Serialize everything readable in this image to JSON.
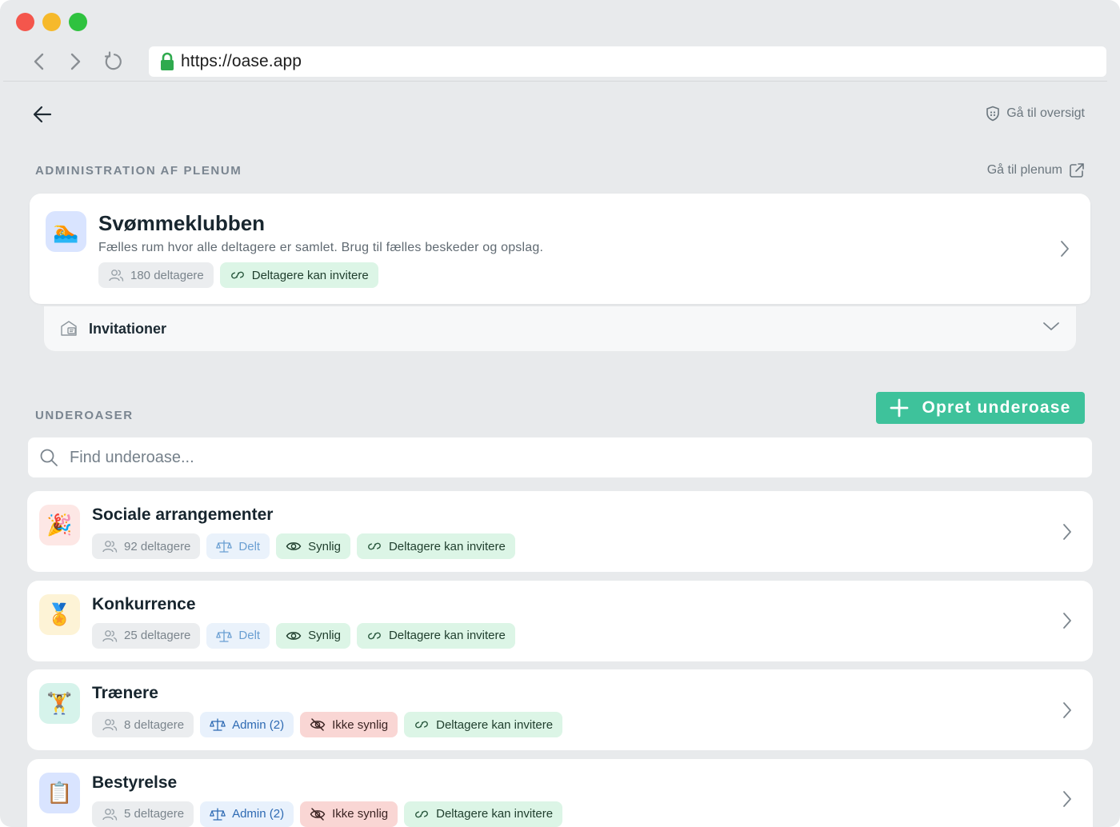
{
  "browser": {
    "url": "https://oase.app"
  },
  "header": {
    "overview_link": "Gå til oversigt"
  },
  "plenum": {
    "section_label": "ADMINISTRATION AF PLENUM",
    "link": "Gå til plenum",
    "emoji": "🏊",
    "title": "Svømmeklubben",
    "description": "Fælles rum hvor alle deltagere er samlet. Brug til fælles beskeder og opslag.",
    "participants": "180 deltagere",
    "invite_tag": "Deltagere kan invitere",
    "invitations_label": "Invitationer"
  },
  "suboases": {
    "section_label": "UNDEROASER",
    "create_button": "Opret underoase",
    "search_placeholder": "Find underoase...",
    "items": [
      {
        "title": "Sociale arrangementer",
        "emoji": "🎉",
        "avatar_bg": "#fde7e5",
        "participants": "92 deltagere",
        "access": "Delt",
        "visibility": "Synlig",
        "invite": "Deltagere kan invitere"
      },
      {
        "title": "Konkurrence",
        "emoji": "🏅",
        "avatar_bg": "#fdf3d6",
        "participants": "25 deltagere",
        "access": "Delt",
        "visibility": "Synlig",
        "invite": "Deltagere kan invitere"
      },
      {
        "title": "Trænere",
        "emoji": "🏋️",
        "avatar_bg": "#d6f3eb",
        "participants": "8 deltagere",
        "access": "Admin (2)",
        "visibility": "Ikke synlig",
        "invite": "Deltagere kan invitere"
      },
      {
        "title": "Bestyrelse",
        "emoji": "📋",
        "avatar_bg": "#d9e4ff",
        "participants": "5 deltagere",
        "access": "Admin (2)",
        "visibility": "Ikke synlig",
        "invite": "Deltagere kan invitere"
      }
    ]
  },
  "colors": {
    "accent": "#3ec29b",
    "background": "#e8eaec"
  }
}
